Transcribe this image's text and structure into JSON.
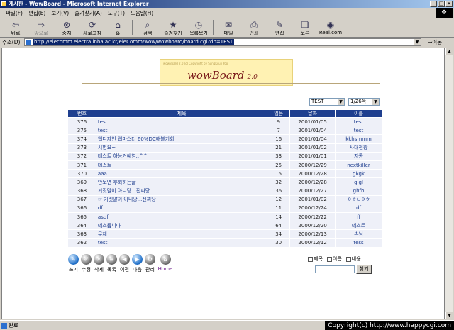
{
  "window": {
    "title": "게시판 - WowBoard - Microsoft Internet Explorer"
  },
  "menu": [
    "파일(F)",
    "편집(E)",
    "보기(V)",
    "즐겨찾기(A)",
    "도구(T)",
    "도움말(H)"
  ],
  "toolbar": [
    {
      "label": "뒤로",
      "icon": "back-arrow-icon"
    },
    {
      "label": "앞으로",
      "icon": "forward-arrow-icon"
    },
    {
      "label": "중지",
      "icon": "stop-icon"
    },
    {
      "label": "새로고침",
      "icon": "refresh-icon"
    },
    {
      "label": "홈",
      "icon": "home-icon"
    },
    {
      "label": "검색",
      "icon": "search-icon"
    },
    {
      "label": "즐겨찾기",
      "icon": "favorites-icon"
    },
    {
      "label": "목록보기",
      "icon": "history-icon"
    },
    {
      "label": "메일",
      "icon": "mail-icon"
    },
    {
      "label": "인쇄",
      "icon": "print-icon"
    },
    {
      "label": "편집",
      "icon": "edit-icon"
    },
    {
      "label": "토론",
      "icon": "discuss-icon"
    },
    {
      "label": "Real.com",
      "icon": "realcom-icon"
    }
  ],
  "address": {
    "label": "주소(D)",
    "url": "http://elecomm.electra.inha.ac.kr/eleComm/wow/wowboard/board.cgi?db=TEST",
    "go": "이동"
  },
  "logo": {
    "small": "wowBoard 2.0 (c) Copyright by SungKyun Yoo",
    "text": "wowBoard",
    "version": "2.0"
  },
  "board_select": "TEST",
  "page_select": "1/26쪽",
  "table": {
    "headers": [
      "번호",
      "제목",
      "읽음",
      "날짜",
      "이름"
    ],
    "rows": [
      {
        "num": "376",
        "title": "test",
        "reads": "9",
        "date": "2001/01/05",
        "name": "test"
      },
      {
        "num": "375",
        "title": "test",
        "reads": "7",
        "date": "2001/01/04",
        "name": "test"
      },
      {
        "num": "374",
        "title": "웹디자인 웹마스터 60%DC해볼기회",
        "reads": "16",
        "date": "2001/01/04",
        "name": "kkhsmmm"
      },
      {
        "num": "373",
        "title": "시험요~",
        "reads": "21",
        "date": "2001/01/02",
        "name": "사대천왕"
      },
      {
        "num": "372",
        "title": "테스트 하능거예염..^^",
        "reads": "33",
        "date": "2001/01/01",
        "name": "자롱"
      },
      {
        "num": "371",
        "title": "테스트",
        "reads": "25",
        "date": "2000/12/29",
        "name": "nextkiller"
      },
      {
        "num": "370",
        "title": "aaa",
        "reads": "15",
        "date": "2000/12/28",
        "name": "gkgk"
      },
      {
        "num": "369",
        "title": "안보면 후회하는글",
        "reads": "32",
        "date": "2000/12/28",
        "name": "glgl"
      },
      {
        "num": "368",
        "title": "거짓말이 아니당...진짜당",
        "reads": "36",
        "date": "2000/12/27",
        "name": "ghfh"
      },
      {
        "num": "367",
        "title": "☞ 거짓말이 아니당...진짜당",
        "reads": "12",
        "date": "2001/01/02",
        "name": "ㅇㅎㄴㅇㅎ"
      },
      {
        "num": "366",
        "title": "df",
        "reads": "11",
        "date": "2000/12/24",
        "name": "df"
      },
      {
        "num": "365",
        "title": "asdf",
        "reads": "14",
        "date": "2000/12/22",
        "name": "ff"
      },
      {
        "num": "364",
        "title": "테스틉니다",
        "reads": "64",
        "date": "2000/12/20",
        "name": "테스트"
      },
      {
        "num": "363",
        "title": "무제",
        "reads": "34",
        "date": "2000/12/13",
        "name": "손님"
      },
      {
        "num": "362",
        "title": "test",
        "reads": "30",
        "date": "2000/12/12",
        "name": "tess"
      }
    ]
  },
  "nav": [
    "쓰기",
    "수정",
    "삭제",
    "목록",
    "이전",
    "다음",
    "관리",
    "Home"
  ],
  "search": {
    "options": [
      "제목",
      "이름",
      "내용"
    ],
    "button": "찾기"
  },
  "status": {
    "text": "완료",
    "copyright": "Copyright(c) http://www.happycgi.com"
  }
}
